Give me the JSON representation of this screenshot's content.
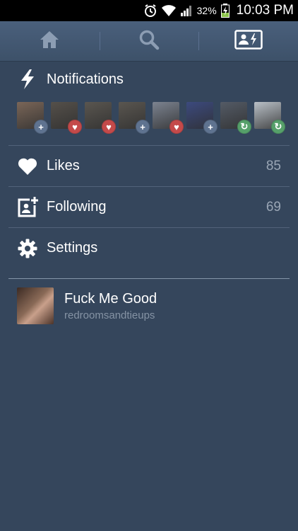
{
  "status": {
    "icons": [
      "alarm-icon",
      "wifi-icon",
      "signal-icon"
    ],
    "battery": "32%",
    "time": "10:03 PM"
  },
  "nav": {
    "tabs": [
      {
        "icon": "home-icon",
        "active": false
      },
      {
        "icon": "search-icon",
        "active": false
      },
      {
        "icon": "activity-icon",
        "active": true
      }
    ]
  },
  "notifications": {
    "label": "Notifications",
    "avatars": [
      {
        "badge": "follow",
        "color": "#7a6658"
      },
      {
        "badge": "like",
        "color": "#55504a"
      },
      {
        "badge": "like",
        "color": "#5a5650"
      },
      {
        "badge": "follow",
        "color": "#5a5650"
      },
      {
        "badge": "like",
        "color": "#7c8390"
      },
      {
        "badge": "follow",
        "color": "#3c4a7e"
      },
      {
        "badge": "reblog",
        "color": "#545b66"
      },
      {
        "badge": "reblog",
        "color": "#b9c0c7"
      }
    ]
  },
  "likes": {
    "label": "Likes",
    "count": "85"
  },
  "following": {
    "label": "Following",
    "count": "69"
  },
  "settings": {
    "label": "Settings"
  },
  "blog": {
    "title": "Fuck Me Good",
    "subtitle": "redroomsandtieups"
  },
  "colors": {
    "background": "#35465c",
    "like_badge": "#c44a4a",
    "follow_badge": "#5f7390",
    "reblog_badge": "#56a06a"
  }
}
